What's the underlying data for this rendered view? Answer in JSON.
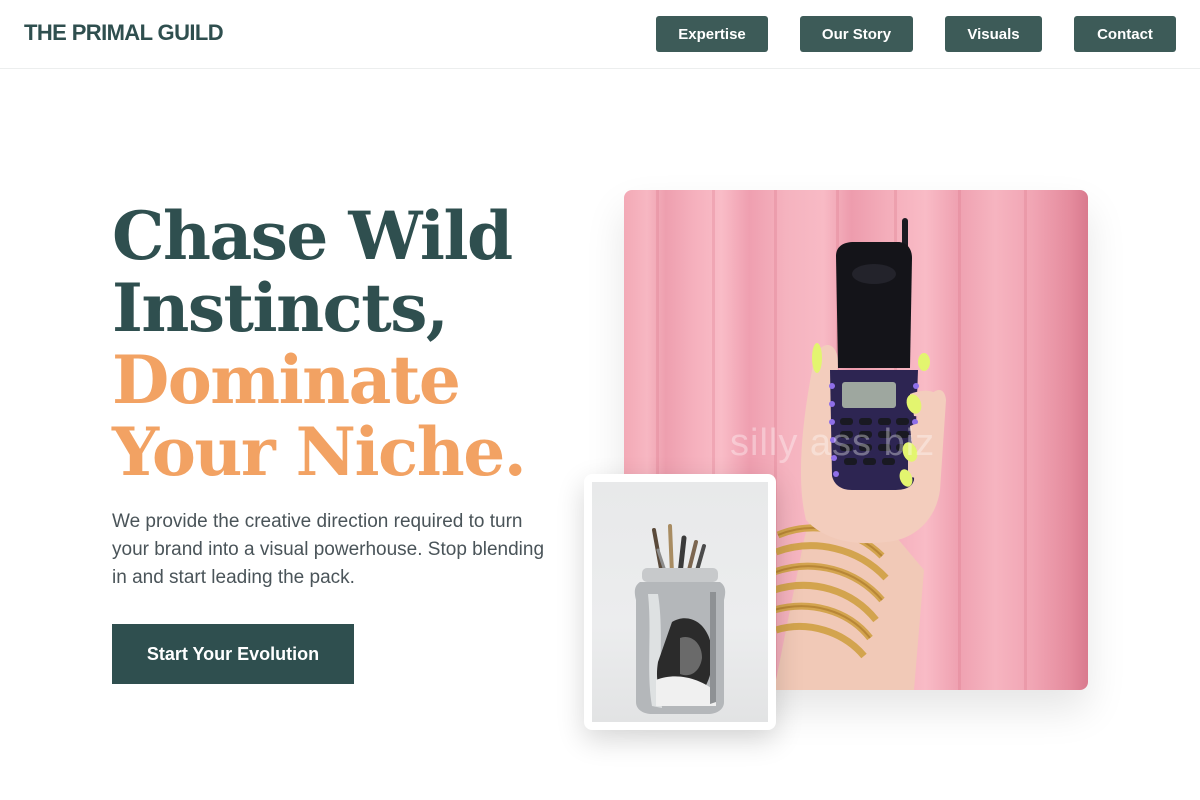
{
  "header": {
    "brand": "THE PRIMAL GUILD",
    "nav": [
      {
        "label": "Expertise"
      },
      {
        "label": "Our Story"
      },
      {
        "label": "Visuals"
      },
      {
        "label": "Contact"
      }
    ]
  },
  "hero": {
    "headline_lines": [
      "Chase Wild",
      "Instincts,",
      "Dominate",
      "Your Niche."
    ],
    "intro": "We provide the creative direction required to turn your brand into a visual powerhouse. Stop blending in and start leading the pack.",
    "cta_label": "Start Your Evolution"
  },
  "images": {
    "main_watermark": "silly ass biz"
  },
  "colors": {
    "primary_dark": "#2f4f4f",
    "nav_button": "#3d5b58",
    "accent": "#f2a263",
    "body_text": "#4a5459"
  }
}
